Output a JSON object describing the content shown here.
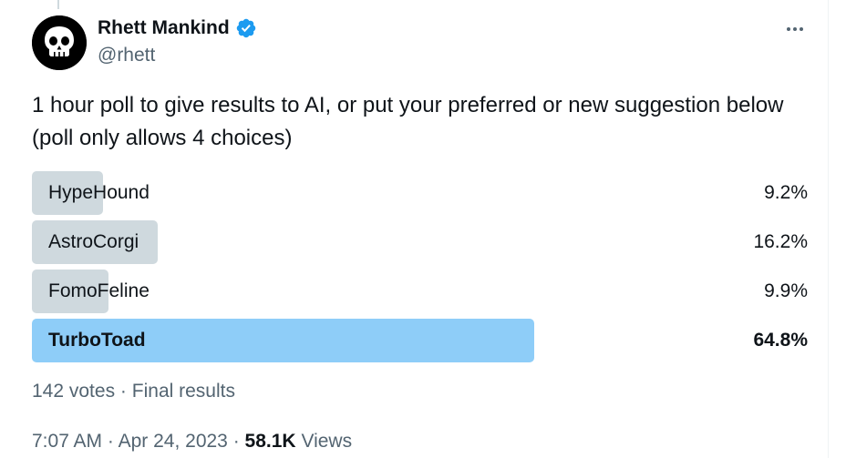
{
  "author": {
    "display_name": "Rhett Mankind",
    "handle": "@rhett",
    "verified": true,
    "avatar_icon": "skull-icon"
  },
  "menu": {
    "icon": "more-horizontal-icon"
  },
  "tweet": {
    "text": "1 hour poll to give results to AI, or put your preferred or new suggestion below (poll only allows 4 choices)"
  },
  "poll": {
    "options": [
      {
        "label": "HypeHound",
        "percent": "9.2%",
        "fraction": 0.092,
        "winner": false
      },
      {
        "label": "AstroCorgi",
        "percent": "16.2%",
        "fraction": 0.162,
        "winner": false
      },
      {
        "label": "FomoFeline",
        "percent": "9.9%",
        "fraction": 0.099,
        "winner": false
      },
      {
        "label": "TurboToad",
        "percent": "64.8%",
        "fraction": 0.648,
        "winner": true
      }
    ],
    "votes": "142 votes",
    "separator": "·",
    "status": "Final results"
  },
  "meta": {
    "time": "7:07 AM",
    "separator": "·",
    "date": "Apr 24, 2023",
    "views_count": "58.1K",
    "views_label": "Views"
  },
  "colors": {
    "bar": "#cfd9de",
    "winner_bar": "#8ecdf8",
    "verified": "#1d9bf0",
    "secondary_text": "#536471"
  }
}
